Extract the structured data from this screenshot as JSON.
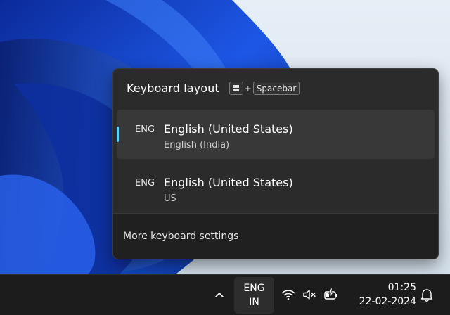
{
  "flyout": {
    "title": "Keyboard layout",
    "shortcut_plus": "+",
    "shortcut_key": "Spacebar",
    "items": [
      {
        "code": "ENG",
        "name": "English (United States)",
        "sub": "English (India)",
        "selected": true
      },
      {
        "code": "ENG",
        "name": "English (United States)",
        "sub": "US",
        "selected": false
      }
    ],
    "more_settings": "More keyboard settings"
  },
  "taskbar": {
    "lang_line1": "ENG",
    "lang_line2": "IN",
    "time": "01:25",
    "date": "22-02-2024",
    "icons": [
      "chevron-up-icon",
      "wifi-icon",
      "speaker-muted-icon",
      "battery-charging-icon",
      "bell-icon"
    ]
  },
  "colors": {
    "accent": "#60cdff",
    "flyout_bg": "#2b2b2b",
    "taskbar_bg": "#1c1c1c",
    "wallpaper_blue": "#1a4fd8"
  }
}
